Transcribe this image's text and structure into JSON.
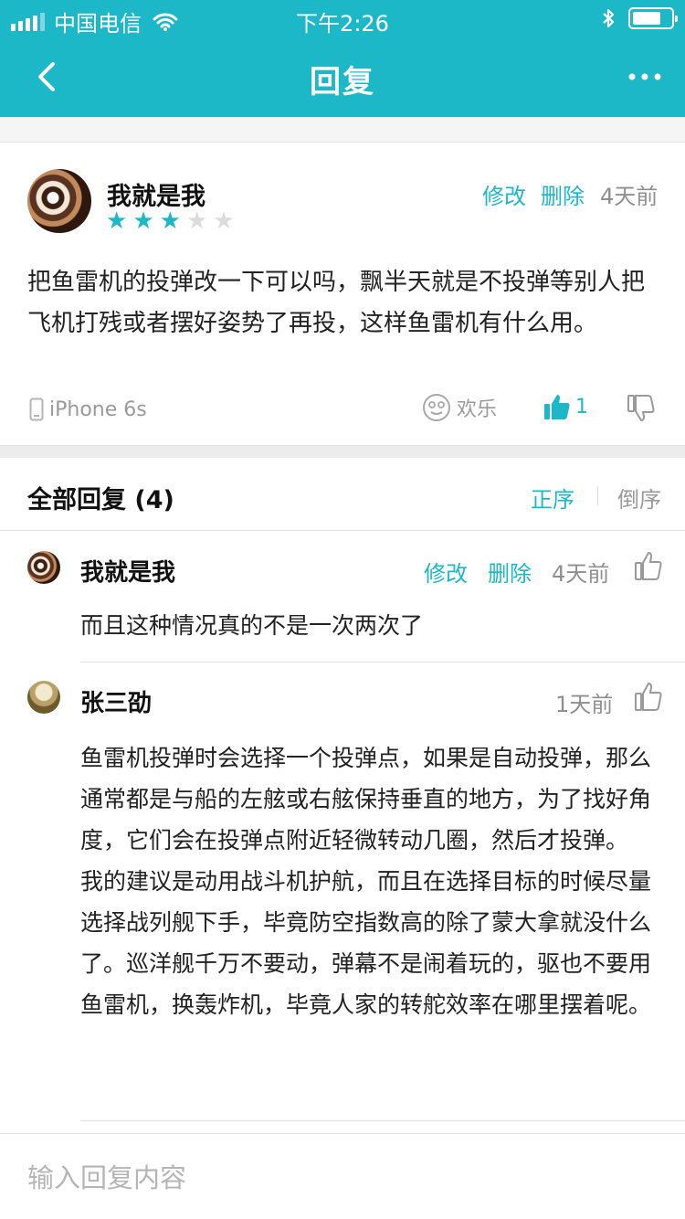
{
  "status_bar": {
    "carrier": "中国电信",
    "time": "下午2:26"
  },
  "nav": {
    "title": "回复",
    "back_icon": "chevron-left-icon",
    "more_icon": "more-dots-icon"
  },
  "post": {
    "author": "我就是我",
    "rating": 3,
    "rating_max": 5,
    "edit_label": "修改",
    "delete_label": "删除",
    "time": "4天前",
    "body": "把鱼雷机的投弹改一下可以吗，飘半天就是不投弹等别人把飞机打残或者摆好姿势了再投，这样鱼雷机有什么用。",
    "device": "iPhone 6s",
    "mood": "欢乐",
    "like_count": "1"
  },
  "replies_section": {
    "title": "全部回复 (4)",
    "sort_asc": "正序",
    "sort_desc": "倒序"
  },
  "replies": [
    {
      "author": "我就是我",
      "edit_label": "修改",
      "delete_label": "删除",
      "time": "4天前",
      "body": "而且这种情况真的不是一次两次了"
    },
    {
      "author": "张三劭",
      "time": "1天前",
      "body_p1": "鱼雷机投弹时会选择一个投弹点，如果是自动投弹，那么通常都是与船的左舷或右舷保持垂直的地方，为了找好角度，它们会在投弹点附近轻微转动几圈，然后才投弹。",
      "body_p2": "我的建议是动用战斗机护航，而且在选择目标的时候尽量选择战列舰下手，毕竟防空指数高的除了蒙大拿就没什么了。巡洋舰千万不要动，弹幕不是闹着玩的，驱也不要用鱼雷机，换轰炸机，毕竟人家的转舵效率在哪里摆着呢。"
    }
  ],
  "input": {
    "placeholder": "输入回复内容"
  },
  "colors": {
    "accent": "#1cb8c8",
    "muted": "#9a9a9a"
  }
}
